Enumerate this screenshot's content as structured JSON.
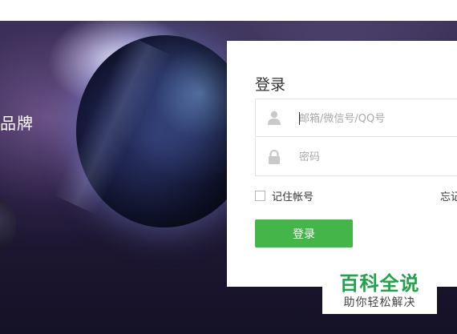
{
  "hero": {
    "brand_text": "品牌"
  },
  "login": {
    "title": "登录",
    "username_placeholder": "邮箱/微信号/QQ号",
    "password_placeholder": "密码",
    "remember_label": "记住帐号",
    "forgot_label": "忘记",
    "submit_label": "登录",
    "accent_color": "#43b549"
  },
  "watermark": {
    "title": "百科全说",
    "subtitle": "助你轻松解决",
    "color": "#21a34a"
  },
  "icons": {
    "user": "person-icon",
    "password": "lock-icon"
  }
}
